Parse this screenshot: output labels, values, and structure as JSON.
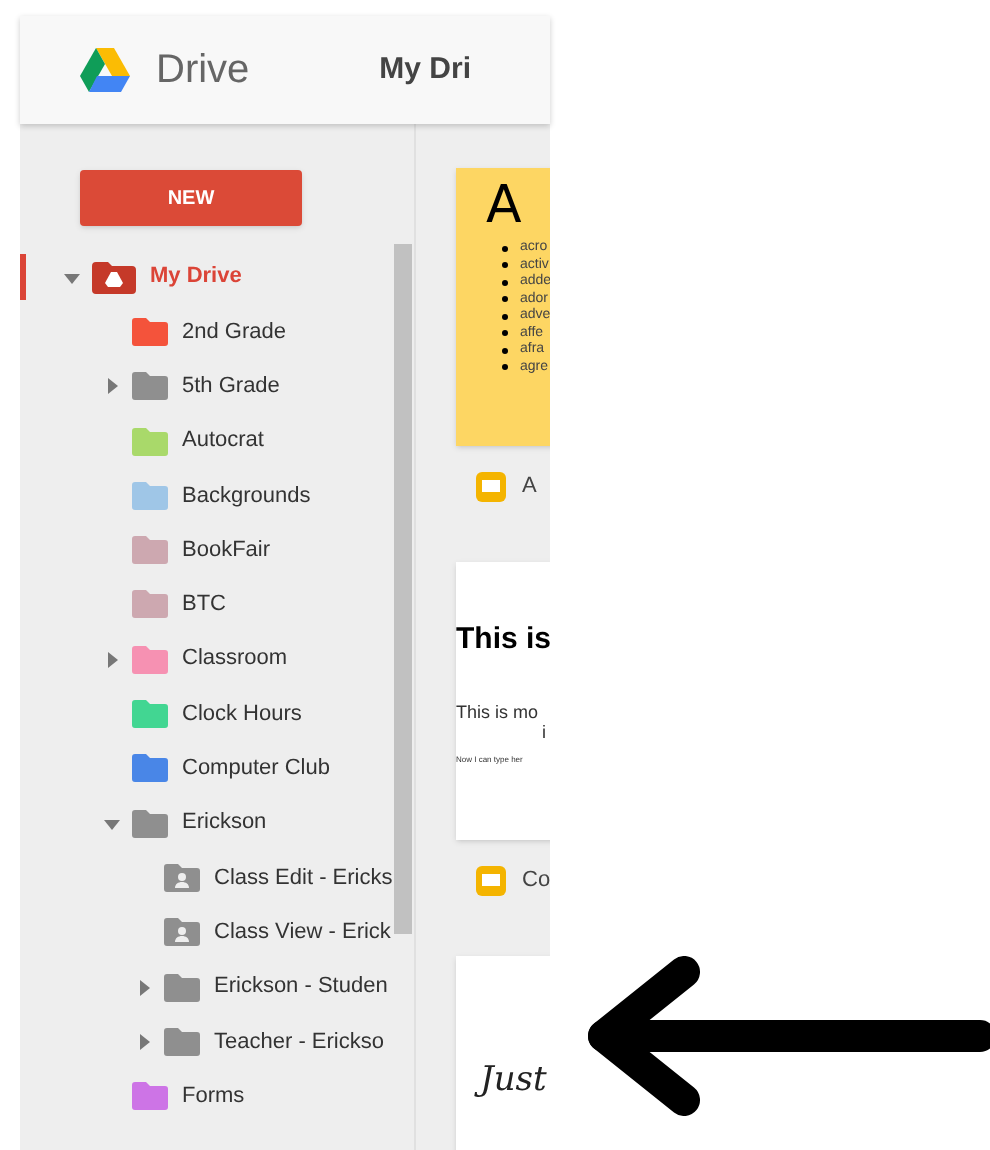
{
  "header": {
    "app_name": "Drive",
    "page_title": "My Dri"
  },
  "new_button": "NEW",
  "tree": [
    {
      "label": "My Drive",
      "kind": "root",
      "selected": true,
      "expanded": true,
      "children": [
        {
          "label": "2nd Grade",
          "kind": "folder",
          "color": "#f4533b",
          "selected": false
        },
        {
          "label": "5th Grade",
          "kind": "folder",
          "color": "#8f8f8f",
          "selected": false,
          "expanded": false
        },
        {
          "label": "Autocrat",
          "kind": "folder",
          "color": "#a9d96a",
          "selected": false
        },
        {
          "label": "Backgrounds",
          "kind": "folder",
          "color": "#9fc6e7",
          "selected": false
        },
        {
          "label": "BookFair",
          "kind": "folder",
          "color": "#cda8b0",
          "selected": false
        },
        {
          "label": "BTC",
          "kind": "folder",
          "color": "#cda8b0",
          "selected": false
        },
        {
          "label": "Classroom",
          "kind": "folder",
          "color": "#f691b2",
          "selected": false,
          "expanded": false
        },
        {
          "label": "Clock Hours",
          "kind": "folder",
          "color": "#42d692",
          "selected": false
        },
        {
          "label": "Computer Club",
          "kind": "folder",
          "color": "#4986e7",
          "selected": false
        },
        {
          "label": "Erickson",
          "kind": "folder",
          "color": "#8f8f8f",
          "selected": false,
          "expanded": true,
          "children": [
            {
              "label": "Class Edit - Ericks",
              "kind": "shared",
              "color": "#8f8f8f",
              "selected": false
            },
            {
              "label": "Class View - Erick",
              "kind": "shared",
              "color": "#8f8f8f",
              "selected": false
            },
            {
              "label": "Erickson - Studen",
              "kind": "folder",
              "color": "#8f8f8f",
              "selected": false,
              "expanded": false
            },
            {
              "label": "Teacher - Erickso",
              "kind": "folder",
              "color": "#8f8f8f",
              "selected": false,
              "expanded": false
            }
          ]
        },
        {
          "label": "Forms",
          "kind": "folder",
          "color": "#cd74e6",
          "selected": false
        }
      ]
    }
  ],
  "files": [
    {
      "kind": "word_list",
      "name": "A",
      "heading": "A",
      "bullets": [
        "acro",
        "activ",
        "adde",
        "ador",
        "adve",
        "affe",
        "afra",
        "agre"
      ]
    },
    {
      "kind": "text_page",
      "name": "Co",
      "heading": "This is",
      "lines": [
        "This is mo",
        "i",
        "Now I can type her"
      ]
    },
    {
      "kind": "script_page",
      "heading": "Just"
    }
  ]
}
